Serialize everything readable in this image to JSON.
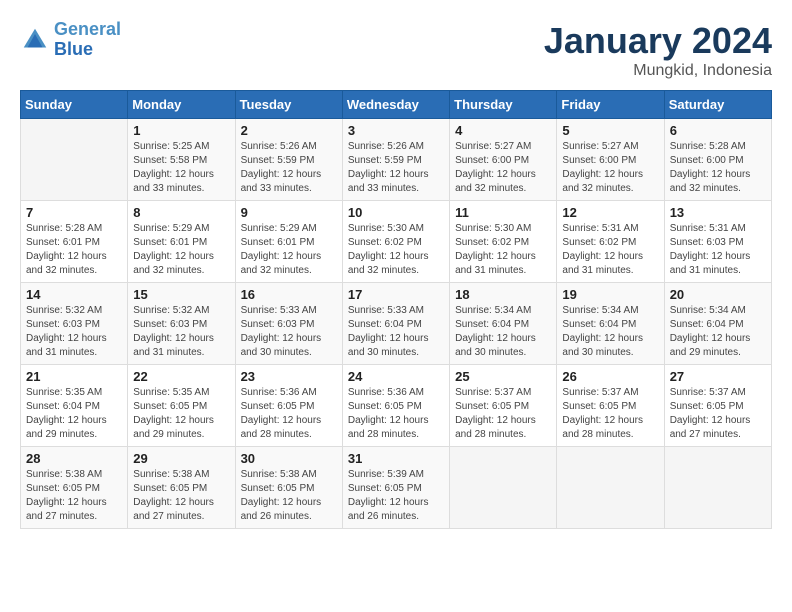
{
  "logo": {
    "line1": "General",
    "line2": "Blue"
  },
  "title": "January 2024",
  "location": "Mungkid, Indonesia",
  "days_of_week": [
    "Sunday",
    "Monday",
    "Tuesday",
    "Wednesday",
    "Thursday",
    "Friday",
    "Saturday"
  ],
  "weeks": [
    [
      {
        "day": null
      },
      {
        "day": "1",
        "sunrise": "Sunrise: 5:25 AM",
        "sunset": "Sunset: 5:58 PM",
        "daylight": "Daylight: 12 hours and 33 minutes."
      },
      {
        "day": "2",
        "sunrise": "Sunrise: 5:26 AM",
        "sunset": "Sunset: 5:59 PM",
        "daylight": "Daylight: 12 hours and 33 minutes."
      },
      {
        "day": "3",
        "sunrise": "Sunrise: 5:26 AM",
        "sunset": "Sunset: 5:59 PM",
        "daylight": "Daylight: 12 hours and 33 minutes."
      },
      {
        "day": "4",
        "sunrise": "Sunrise: 5:27 AM",
        "sunset": "Sunset: 6:00 PM",
        "daylight": "Daylight: 12 hours and 32 minutes."
      },
      {
        "day": "5",
        "sunrise": "Sunrise: 5:27 AM",
        "sunset": "Sunset: 6:00 PM",
        "daylight": "Daylight: 12 hours and 32 minutes."
      },
      {
        "day": "6",
        "sunrise": "Sunrise: 5:28 AM",
        "sunset": "Sunset: 6:00 PM",
        "daylight": "Daylight: 12 hours and 32 minutes."
      }
    ],
    [
      {
        "day": "7",
        "sunrise": "Sunrise: 5:28 AM",
        "sunset": "Sunset: 6:01 PM",
        "daylight": "Daylight: 12 hours and 32 minutes."
      },
      {
        "day": "8",
        "sunrise": "Sunrise: 5:29 AM",
        "sunset": "Sunset: 6:01 PM",
        "daylight": "Daylight: 12 hours and 32 minutes."
      },
      {
        "day": "9",
        "sunrise": "Sunrise: 5:29 AM",
        "sunset": "Sunset: 6:01 PM",
        "daylight": "Daylight: 12 hours and 32 minutes."
      },
      {
        "day": "10",
        "sunrise": "Sunrise: 5:30 AM",
        "sunset": "Sunset: 6:02 PM",
        "daylight": "Daylight: 12 hours and 32 minutes."
      },
      {
        "day": "11",
        "sunrise": "Sunrise: 5:30 AM",
        "sunset": "Sunset: 6:02 PM",
        "daylight": "Daylight: 12 hours and 31 minutes."
      },
      {
        "day": "12",
        "sunrise": "Sunrise: 5:31 AM",
        "sunset": "Sunset: 6:02 PM",
        "daylight": "Daylight: 12 hours and 31 minutes."
      },
      {
        "day": "13",
        "sunrise": "Sunrise: 5:31 AM",
        "sunset": "Sunset: 6:03 PM",
        "daylight": "Daylight: 12 hours and 31 minutes."
      }
    ],
    [
      {
        "day": "14",
        "sunrise": "Sunrise: 5:32 AM",
        "sunset": "Sunset: 6:03 PM",
        "daylight": "Daylight: 12 hours and 31 minutes."
      },
      {
        "day": "15",
        "sunrise": "Sunrise: 5:32 AM",
        "sunset": "Sunset: 6:03 PM",
        "daylight": "Daylight: 12 hours and 31 minutes."
      },
      {
        "day": "16",
        "sunrise": "Sunrise: 5:33 AM",
        "sunset": "Sunset: 6:03 PM",
        "daylight": "Daylight: 12 hours and 30 minutes."
      },
      {
        "day": "17",
        "sunrise": "Sunrise: 5:33 AM",
        "sunset": "Sunset: 6:04 PM",
        "daylight": "Daylight: 12 hours and 30 minutes."
      },
      {
        "day": "18",
        "sunrise": "Sunrise: 5:34 AM",
        "sunset": "Sunset: 6:04 PM",
        "daylight": "Daylight: 12 hours and 30 minutes."
      },
      {
        "day": "19",
        "sunrise": "Sunrise: 5:34 AM",
        "sunset": "Sunset: 6:04 PM",
        "daylight": "Daylight: 12 hours and 30 minutes."
      },
      {
        "day": "20",
        "sunrise": "Sunrise: 5:34 AM",
        "sunset": "Sunset: 6:04 PM",
        "daylight": "Daylight: 12 hours and 29 minutes."
      }
    ],
    [
      {
        "day": "21",
        "sunrise": "Sunrise: 5:35 AM",
        "sunset": "Sunset: 6:04 PM",
        "daylight": "Daylight: 12 hours and 29 minutes."
      },
      {
        "day": "22",
        "sunrise": "Sunrise: 5:35 AM",
        "sunset": "Sunset: 6:05 PM",
        "daylight": "Daylight: 12 hours and 29 minutes."
      },
      {
        "day": "23",
        "sunrise": "Sunrise: 5:36 AM",
        "sunset": "Sunset: 6:05 PM",
        "daylight": "Daylight: 12 hours and 28 minutes."
      },
      {
        "day": "24",
        "sunrise": "Sunrise: 5:36 AM",
        "sunset": "Sunset: 6:05 PM",
        "daylight": "Daylight: 12 hours and 28 minutes."
      },
      {
        "day": "25",
        "sunrise": "Sunrise: 5:37 AM",
        "sunset": "Sunset: 6:05 PM",
        "daylight": "Daylight: 12 hours and 28 minutes."
      },
      {
        "day": "26",
        "sunrise": "Sunrise: 5:37 AM",
        "sunset": "Sunset: 6:05 PM",
        "daylight": "Daylight: 12 hours and 28 minutes."
      },
      {
        "day": "27",
        "sunrise": "Sunrise: 5:37 AM",
        "sunset": "Sunset: 6:05 PM",
        "daylight": "Daylight: 12 hours and 27 minutes."
      }
    ],
    [
      {
        "day": "28",
        "sunrise": "Sunrise: 5:38 AM",
        "sunset": "Sunset: 6:05 PM",
        "daylight": "Daylight: 12 hours and 27 minutes."
      },
      {
        "day": "29",
        "sunrise": "Sunrise: 5:38 AM",
        "sunset": "Sunset: 6:05 PM",
        "daylight": "Daylight: 12 hours and 27 minutes."
      },
      {
        "day": "30",
        "sunrise": "Sunrise: 5:38 AM",
        "sunset": "Sunset: 6:05 PM",
        "daylight": "Daylight: 12 hours and 26 minutes."
      },
      {
        "day": "31",
        "sunrise": "Sunrise: 5:39 AM",
        "sunset": "Sunset: 6:05 PM",
        "daylight": "Daylight: 12 hours and 26 minutes."
      },
      {
        "day": null
      },
      {
        "day": null
      },
      {
        "day": null
      }
    ]
  ]
}
